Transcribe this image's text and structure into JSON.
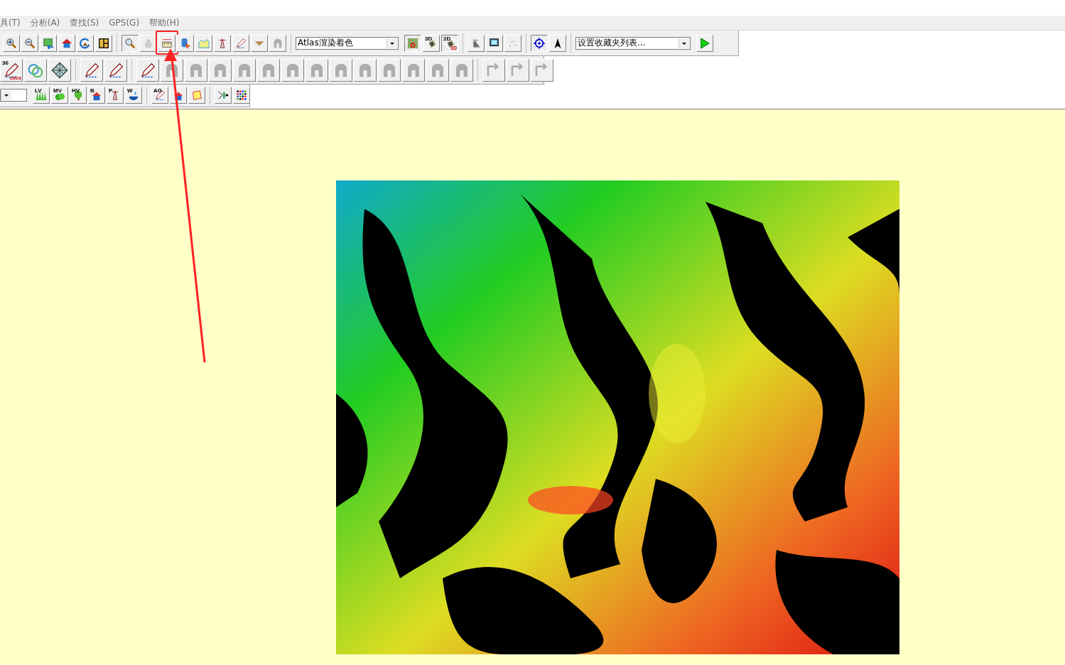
{
  "menu": [
    {
      "label": "具(T)"
    },
    {
      "label": "分析(A)"
    },
    {
      "label": "查找(S)"
    },
    {
      "label": "GPS(G)"
    },
    {
      "label": "帮助(H)"
    }
  ],
  "toolbars": [
    {
      "groups": [
        [
          {
            "kind": "button",
            "pressed": false,
            "disabled": false
          },
          {
            "kind": "button",
            "pressed": false,
            "disabled": false
          },
          {
            "kind": "button",
            "pressed": false,
            "disabled": false
          },
          {
            "kind": "button",
            "pressed": false,
            "disabled": false
          },
          {
            "kind": "button",
            "pressed": false,
            "disabled": false
          },
          {
            "kind": "button",
            "pressed": false,
            "disabled": false
          }
        ],
        [
          {
            "kind": "button",
            "pressed": true,
            "disabled": false
          },
          {
            "kind": "button",
            "pressed": false,
            "disabled": true
          },
          {
            "kind": "button",
            "pressed": false,
            "disabled": false,
            "annotated": true
          },
          {
            "kind": "button",
            "pressed": false,
            "disabled": false
          },
          {
            "kind": "button",
            "pressed": false,
            "disabled": false
          },
          {
            "kind": "button",
            "pressed": false,
            "disabled": false
          },
          {
            "kind": "button",
            "pressed": false,
            "disabled": false
          },
          {
            "kind": "button",
            "pressed": false,
            "disabled": false
          },
          {
            "kind": "button",
            "pressed": false,
            "disabled": true
          }
        ],
        [
          {
            "kind": "dropdown",
            "value": "Atlas渲染着色"
          },
          {
            "kind": "button",
            "pressed": true,
            "disabled": false
          },
          {
            "kind": "button",
            "pressed": false,
            "disabled": false,
            "label": "3D"
          },
          {
            "kind": "button",
            "pressed": true,
            "disabled": false,
            "label": "2D",
            "sublabel": "3D"
          }
        ],
        [
          {
            "kind": "button",
            "pressed": false,
            "disabled": true
          },
          {
            "kind": "button",
            "pressed": false,
            "disabled": false
          },
          {
            "kind": "button",
            "pressed": false,
            "disabled": true
          }
        ],
        [
          {
            "kind": "button",
            "pressed": true,
            "disabled": false
          },
          {
            "kind": "button",
            "pressed": false,
            "disabled": false
          }
        ],
        [
          {
            "kind": "dropdown",
            "value": "设置收藏夹列表..."
          },
          {
            "kind": "button",
            "pressed": false,
            "disabled": false
          }
        ]
      ]
    },
    {
      "groups": [
        [
          {
            "kind": "button",
            "pressed": false,
            "disabled": false,
            "label": "36",
            "sublabel": "coco"
          },
          {
            "kind": "button",
            "pressed": false,
            "disabled": false
          },
          {
            "kind": "button",
            "pressed": false,
            "disabled": false
          }
        ],
        [
          {
            "kind": "button",
            "pressed": false,
            "disabled": false
          },
          {
            "kind": "button",
            "pressed": false,
            "disabled": false
          }
        ],
        [
          {
            "kind": "button",
            "pressed": false,
            "disabled": false
          },
          {
            "kind": "button",
            "pressed": false,
            "disabled": true
          },
          {
            "kind": "button",
            "pressed": false,
            "disabled": true
          },
          {
            "kind": "button",
            "pressed": false,
            "disabled": true
          },
          {
            "kind": "button",
            "pressed": false,
            "disabled": true
          },
          {
            "kind": "button",
            "pressed": false,
            "disabled": true
          },
          {
            "kind": "button",
            "pressed": false,
            "disabled": true
          },
          {
            "kind": "button",
            "pressed": false,
            "disabled": true
          },
          {
            "kind": "button",
            "pressed": false,
            "disabled": true
          },
          {
            "kind": "button",
            "pressed": false,
            "disabled": true
          },
          {
            "kind": "button",
            "pressed": false,
            "disabled": true
          },
          {
            "kind": "button",
            "pressed": false,
            "disabled": true
          },
          {
            "kind": "button",
            "pressed": false,
            "disabled": true
          },
          {
            "kind": "button",
            "pressed": false,
            "disabled": true
          }
        ],
        [
          {
            "kind": "button",
            "pressed": false,
            "disabled": true
          },
          {
            "kind": "button",
            "pressed": false,
            "disabled": true
          },
          {
            "kind": "button",
            "pressed": false,
            "disabled": true
          }
        ]
      ]
    },
    {
      "groups": [
        [
          {
            "kind": "dropdown"
          },
          {
            "kind": "button",
            "pressed": false,
            "disabled": false,
            "label": "LV"
          },
          {
            "kind": "button",
            "pressed": false,
            "disabled": false,
            "label": "MV"
          },
          {
            "kind": "button",
            "pressed": false,
            "disabled": false,
            "label": "HV"
          },
          {
            "kind": "button",
            "pressed": false,
            "disabled": false,
            "label": "B"
          },
          {
            "kind": "button",
            "pressed": false,
            "disabled": false,
            "label": "P"
          },
          {
            "kind": "button",
            "pressed": false,
            "disabled": false,
            "label": "W"
          }
        ],
        [
          {
            "kind": "button",
            "pressed": false,
            "disabled": false,
            "label": "AG"
          },
          {
            "kind": "button",
            "pressed": false,
            "disabled": false
          },
          {
            "kind": "button",
            "pressed": false,
            "disabled": false
          }
        ],
        [
          {
            "kind": "button",
            "pressed": false,
            "disabled": false
          },
          {
            "kind": "button",
            "pressed": false,
            "disabled": false
          }
        ]
      ]
    }
  ]
}
